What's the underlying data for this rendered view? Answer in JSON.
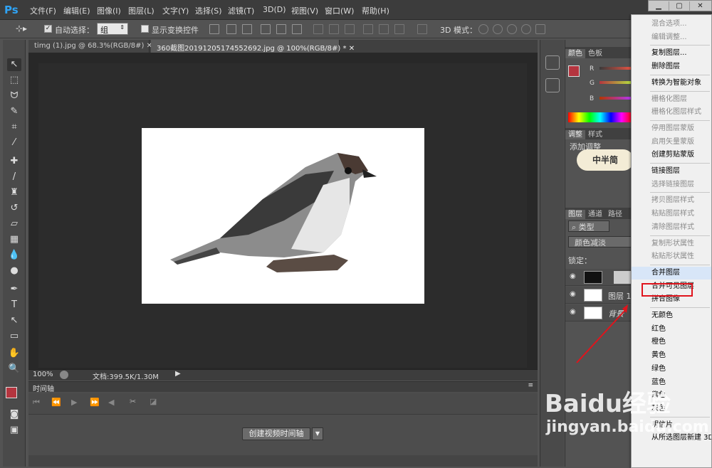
{
  "app": {
    "logo": "Ps"
  },
  "menu": [
    "文件(F)",
    "编辑(E)",
    "图像(I)",
    "图层(L)",
    "文字(Y)",
    "选择(S)",
    "滤镜(T)",
    "3D(D)",
    "视图(V)",
    "窗口(W)",
    "帮助(H)"
  ],
  "options": {
    "auto_select_label": "自动选择：",
    "auto_select_value": "组",
    "show_transform": "显示变换控件",
    "mode_3d": "3D 模式："
  },
  "tabs": [
    "timg (1).jpg @ 68.3%(RGB/8#)",
    "360截图20191205174552692.jpg @ 100%(RGB/8#) *"
  ],
  "status": {
    "zoom": "100%",
    "doc": "文档:399.5K/1.30M"
  },
  "timeline": {
    "title": "时间轴",
    "create_button": "创建视频时间轴"
  },
  "panels": {
    "color_tabs": [
      "颜色",
      "色板"
    ],
    "rgb": [
      "R",
      "G",
      "B"
    ],
    "adjust_tabs": [
      "调整",
      "样式"
    ],
    "adjust_label": "添加调整",
    "watermark": "中半简",
    "layer_tabs": [
      "图层",
      "通道",
      "路径"
    ],
    "kind": "类型",
    "blend": "颜色减淡",
    "lock": "锁定：",
    "layers": [
      "",
      "图层 1",
      "背景"
    ]
  },
  "context_menu": {
    "items": [
      {
        "label": "混合选项...",
        "disabled": true
      },
      {
        "label": "编辑调整...",
        "disabled": true
      },
      {
        "sep": true
      },
      {
        "label": "复制图层...",
        "disabled": false
      },
      {
        "label": "删除图层",
        "disabled": false
      },
      {
        "sep": true
      },
      {
        "label": "转换为智能对象",
        "disabled": false
      },
      {
        "sep": true
      },
      {
        "label": "栅格化图层",
        "disabled": true
      },
      {
        "label": "栅格化图层样式",
        "disabled": true
      },
      {
        "sep": true
      },
      {
        "label": "停用图层蒙版",
        "disabled": true
      },
      {
        "label": "启用矢量蒙版",
        "disabled": true
      },
      {
        "label": "创建剪贴蒙版",
        "disabled": false
      },
      {
        "sep": true
      },
      {
        "label": "链接图层",
        "disabled": false
      },
      {
        "label": "选择链接图层",
        "disabled": true
      },
      {
        "sep": true
      },
      {
        "label": "拷贝图层样式",
        "disabled": true
      },
      {
        "label": "粘贴图层样式",
        "disabled": true
      },
      {
        "label": "清除图层样式",
        "disabled": true
      },
      {
        "sep": true
      },
      {
        "label": "复制形状属性",
        "disabled": true
      },
      {
        "label": "粘贴形状属性",
        "disabled": true
      },
      {
        "sep": true
      },
      {
        "label": "合并图层",
        "disabled": false,
        "highlight": true
      },
      {
        "label": "合并可见图层",
        "disabled": false
      },
      {
        "label": "拼合图像",
        "disabled": false
      },
      {
        "sep": true
      },
      {
        "label": "无颜色",
        "disabled": false
      },
      {
        "label": "红色",
        "disabled": false
      },
      {
        "label": "橙色",
        "disabled": false
      },
      {
        "label": "黄色",
        "disabled": false
      },
      {
        "label": "绿色",
        "disabled": false
      },
      {
        "label": "蓝色",
        "disabled": false
      },
      {
        "label": "紫色",
        "disabled": false
      },
      {
        "label": "灰色",
        "disabled": false
      },
      {
        "sep": true
      },
      {
        "label": "明信片",
        "disabled": false
      },
      {
        "label": "从所选图层新建 3D",
        "disabled": false
      }
    ]
  },
  "watermark": {
    "brand": "Baidu经验",
    "url": "jingyan.baidu.com"
  },
  "colors": {
    "foreground": "#b5353f",
    "accent": "#e0141c",
    "highlight_row": "#d8e6f8"
  }
}
